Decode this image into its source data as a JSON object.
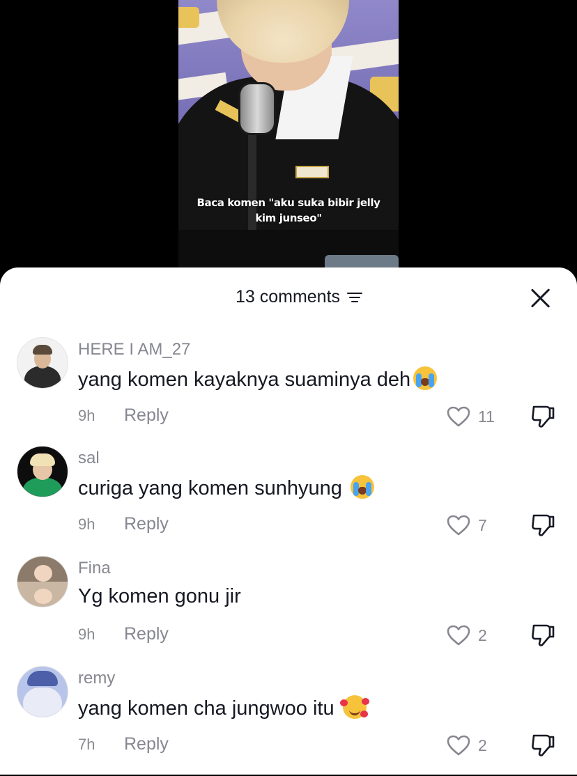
{
  "video": {
    "caption_line1": "Baca komen \"aku suka bibir jelly",
    "caption_line2": "kim junseo\""
  },
  "header": {
    "comment_count": "13 comments"
  },
  "comments": [
    {
      "username": "HERE I AM_27",
      "text": "yang komen kayaknya suaminya deh",
      "emoji": "loudly-crying-face",
      "time": "9h",
      "reply": "Reply",
      "likes": "11"
    },
    {
      "username": "sal",
      "text": "curiga yang komen sunhyung ",
      "emoji": "loudly-crying-face",
      "time": "9h",
      "reply": "Reply",
      "likes": "7"
    },
    {
      "username": "Fina",
      "text": "Yg komen gonu jir",
      "emoji": "",
      "time": "9h",
      "reply": "Reply",
      "likes": "2"
    },
    {
      "username": "remy",
      "text": "yang komen cha jungwoo itu ",
      "emoji": "smiling-face-with-hearts",
      "time": "7h",
      "reply": "Reply",
      "likes": "2"
    }
  ],
  "colors": {
    "text_primary": "#161823",
    "text_secondary": "#868790",
    "sheet_background": "#ffffff"
  }
}
